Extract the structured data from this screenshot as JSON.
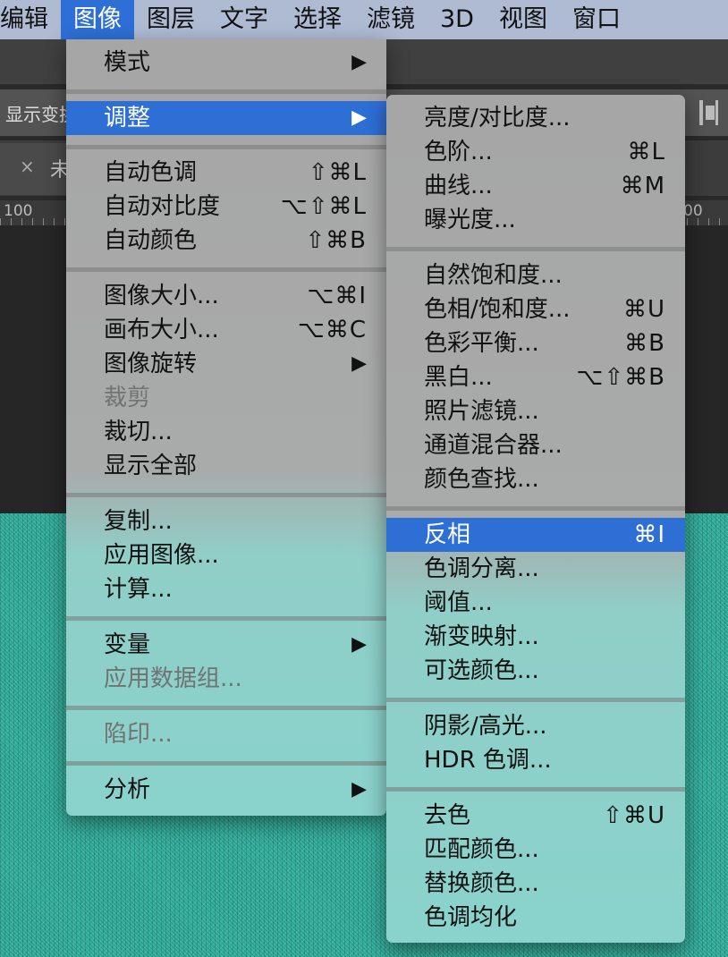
{
  "menubar": {
    "items": [
      "编辑",
      "图像",
      "图层",
      "文字",
      "选择",
      "滤镜",
      "3D",
      "视图",
      "窗口"
    ],
    "active_index": 1
  },
  "options_bar": {
    "label": "显示变换"
  },
  "tab": {
    "close_glyph": "×",
    "title": "未"
  },
  "ruler": {
    "left": "100",
    "right": "00"
  },
  "colors": {
    "accent": "#2e6fd6",
    "menubar": "#aebbd3",
    "canvas": "#33b3a0"
  },
  "image_menu": {
    "mode": {
      "label": "模式",
      "arrow": "▶"
    },
    "adjust": {
      "label": "调整",
      "arrow": "▶"
    },
    "auto_tone": {
      "label": "自动色调",
      "shortcut": "⇧⌘L"
    },
    "auto_contrast": {
      "label": "自动对比度",
      "shortcut": "⌥⇧⌘L"
    },
    "auto_color": {
      "label": "自动颜色",
      "shortcut": "⇧⌘B"
    },
    "image_size": {
      "label": "图像大小...",
      "shortcut": "⌥⌘I"
    },
    "canvas_size": {
      "label": "画布大小...",
      "shortcut": "⌥⌘C"
    },
    "image_rotation": {
      "label": "图像旋转",
      "arrow": "▶"
    },
    "crop": {
      "label": "裁剪"
    },
    "trim": {
      "label": "裁切..."
    },
    "reveal_all": {
      "label": "显示全部"
    },
    "duplicate": {
      "label": "复制..."
    },
    "apply_image": {
      "label": "应用图像..."
    },
    "calculations": {
      "label": "计算..."
    },
    "variables": {
      "label": "变量",
      "arrow": "▶"
    },
    "apply_data_set": {
      "label": "应用数据组..."
    },
    "trap": {
      "label": "陷印..."
    },
    "analysis": {
      "label": "分析",
      "arrow": "▶"
    }
  },
  "adjust_menu": {
    "brightness_contrast": {
      "label": "亮度/对比度..."
    },
    "levels": {
      "label": "色阶...",
      "shortcut": "⌘L"
    },
    "curves": {
      "label": "曲线...",
      "shortcut": "⌘M"
    },
    "exposure": {
      "label": "曝光度..."
    },
    "vibrance": {
      "label": "自然饱和度..."
    },
    "hue_saturation": {
      "label": "色相/饱和度...",
      "shortcut": "⌘U"
    },
    "color_balance": {
      "label": "色彩平衡...",
      "shortcut": "⌘B"
    },
    "black_white": {
      "label": "黑白...",
      "shortcut": "⌥⇧⌘B"
    },
    "photo_filter": {
      "label": "照片滤镜..."
    },
    "channel_mixer": {
      "label": "通道混合器..."
    },
    "color_lookup": {
      "label": "颜色查找..."
    },
    "invert": {
      "label": "反相",
      "shortcut": "⌘I"
    },
    "posterize": {
      "label": "色调分离..."
    },
    "threshold": {
      "label": "阈值..."
    },
    "gradient_map": {
      "label": "渐变映射..."
    },
    "selective_color": {
      "label": "可选颜色..."
    },
    "shadows_highlights": {
      "label": "阴影/高光..."
    },
    "hdr_toning": {
      "label": "HDR 色调..."
    },
    "desaturate": {
      "label": "去色",
      "shortcut": "⇧⌘U"
    },
    "match_color": {
      "label": "匹配颜色..."
    },
    "replace_color": {
      "label": "替换颜色..."
    },
    "equalize": {
      "label": "色调均化"
    }
  }
}
